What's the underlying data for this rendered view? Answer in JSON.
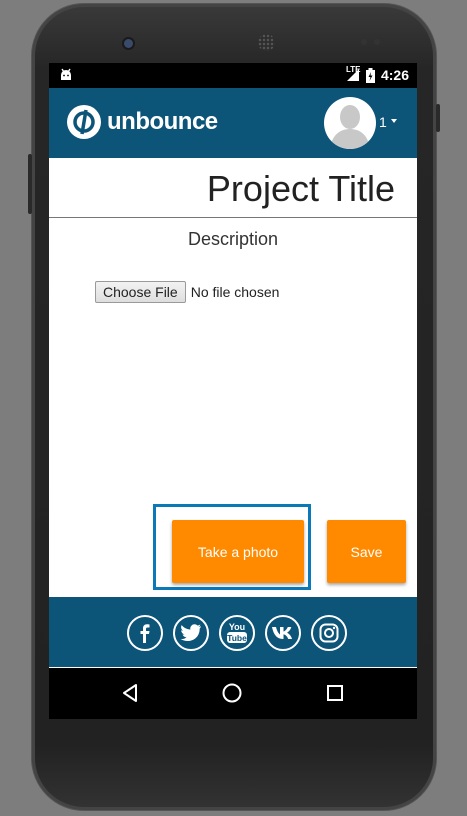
{
  "status_bar": {
    "network": "LTE",
    "time": "4:26"
  },
  "app_bar": {
    "brand": "unbounce",
    "avatar_count": "1"
  },
  "page": {
    "title": "Project Title",
    "description": "Description",
    "file_button": "Choose File",
    "file_status": "No file chosen"
  },
  "actions": {
    "take_photo": "Take a photo",
    "save": "Save"
  },
  "social_icons": [
    "facebook-icon",
    "twitter-icon",
    "youtube-icon",
    "vk-icon",
    "instagram-icon"
  ],
  "colors": {
    "brand_blue": "#0c5478",
    "accent_orange": "#ff8a00",
    "focus_blue": "#0b79b8"
  }
}
